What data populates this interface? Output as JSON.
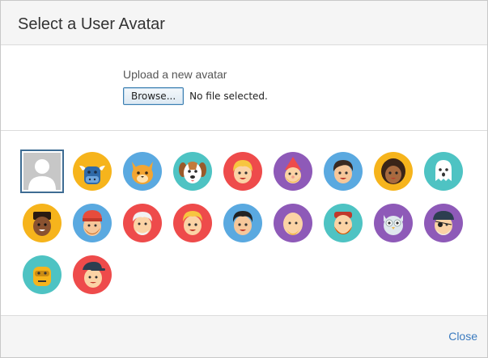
{
  "dialog": {
    "title": "Select a User Avatar",
    "upload": {
      "label": "Upload a new avatar",
      "browse_label": "Browse...",
      "file_status": "No file selected."
    },
    "close_label": "Close"
  },
  "avatars": [
    {
      "name": "default-silhouette-avatar",
      "bg": "#c7c7c7",
      "selected": true
    },
    {
      "name": "bull-avatar",
      "bg": "#f6b41c"
    },
    {
      "name": "cat-avatar",
      "bg": "#5aa9e0"
    },
    {
      "name": "dog-avatar",
      "bg": "#4ec3c3"
    },
    {
      "name": "blonde-kid-avatar",
      "bg": "#ee4b4b"
    },
    {
      "name": "gnome-avatar",
      "bg": "#8e5ab8"
    },
    {
      "name": "dark-hair-boy-avatar",
      "bg": "#5aa9e0"
    },
    {
      "name": "curly-hair-woman-avatar",
      "bg": "#f6b41c"
    },
    {
      "name": "ghost-avatar",
      "bg": "#4ec3c3"
    },
    {
      "name": "flat-top-man-avatar",
      "bg": "#f6b41c"
    },
    {
      "name": "red-beanie-man-avatar",
      "bg": "#5aa9e0"
    },
    {
      "name": "white-hair-old-man-avatar",
      "bg": "#ee4b4b"
    },
    {
      "name": "blonde-boy-avatar",
      "bg": "#ee4b4b"
    },
    {
      "name": "black-hair-boy-avatar",
      "bg": "#5aa9e0"
    },
    {
      "name": "bald-man-avatar",
      "bg": "#8e5ab8"
    },
    {
      "name": "red-beard-man-avatar",
      "bg": "#4ec3c3"
    },
    {
      "name": "owl-avatar",
      "bg": "#8e5ab8"
    },
    {
      "name": "pirate-avatar",
      "bg": "#8e5ab8"
    },
    {
      "name": "robot-avatar",
      "bg": "#4ec3c3"
    },
    {
      "name": "cap-guy-avatar",
      "bg": "#ee4b4b"
    }
  ]
}
